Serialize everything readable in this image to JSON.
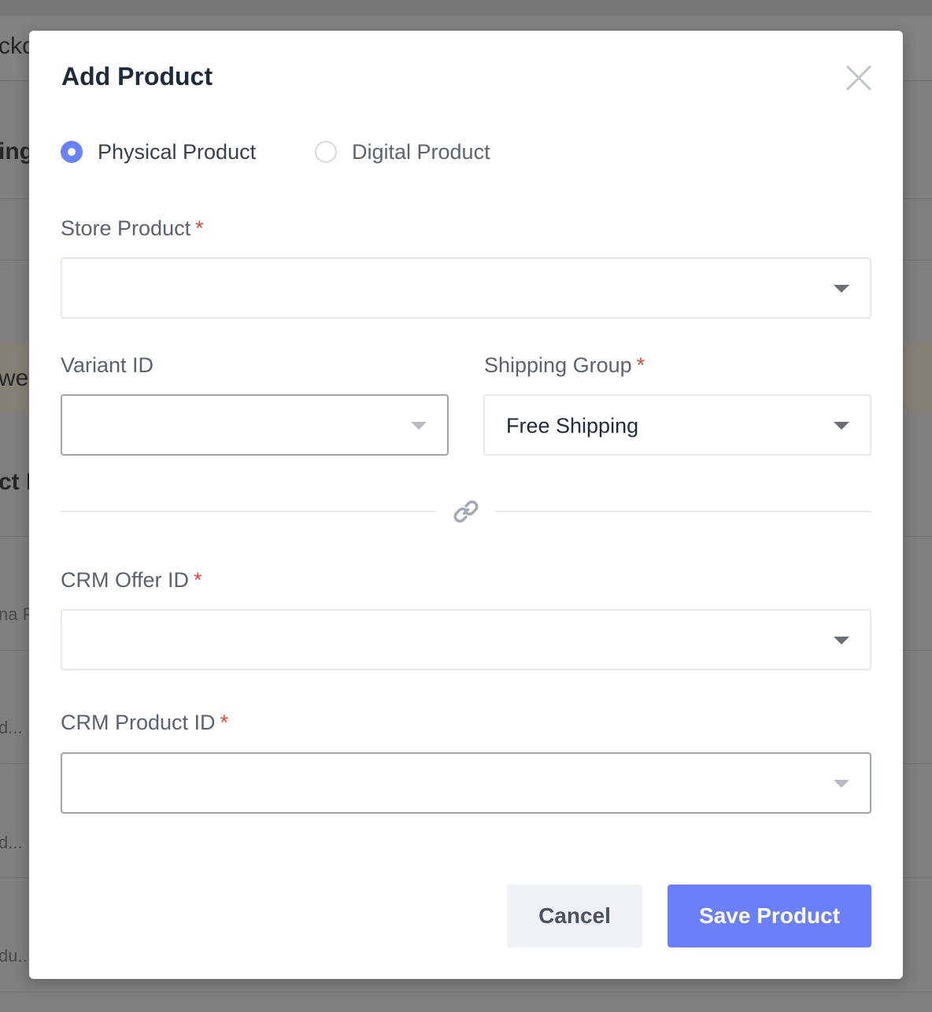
{
  "background": {
    "peeks": [
      "cko",
      "ing",
      "we",
      "ct ID",
      "na P",
      "d...",
      "d...",
      "du..."
    ]
  },
  "modal": {
    "title": "Add Product",
    "product_type": {
      "options": [
        {
          "label": "Physical Product",
          "checked": true
        },
        {
          "label": "Digital Product",
          "checked": false
        }
      ]
    },
    "fields": {
      "store_product": {
        "label": "Store Product",
        "required_mark": "*",
        "value": ""
      },
      "variant_id": {
        "label": "Variant ID",
        "value": ""
      },
      "shipping_group": {
        "label": "Shipping Group",
        "required_mark": "*",
        "value": "Free Shipping"
      },
      "crm_offer_id": {
        "label": "CRM Offer ID",
        "required_mark": "*",
        "value": ""
      },
      "crm_product_id": {
        "label": "CRM Product ID",
        "required_mark": "*",
        "value": ""
      }
    },
    "buttons": {
      "cancel": "Cancel",
      "save": "Save Product"
    }
  },
  "colors": {
    "accent": "#6a7ff8",
    "required": "#e34a3b",
    "overlay": "#7f7f7f"
  },
  "icons": {
    "close": "close-icon",
    "link": "link-icon",
    "dropdown": "chevron-down-icon"
  }
}
